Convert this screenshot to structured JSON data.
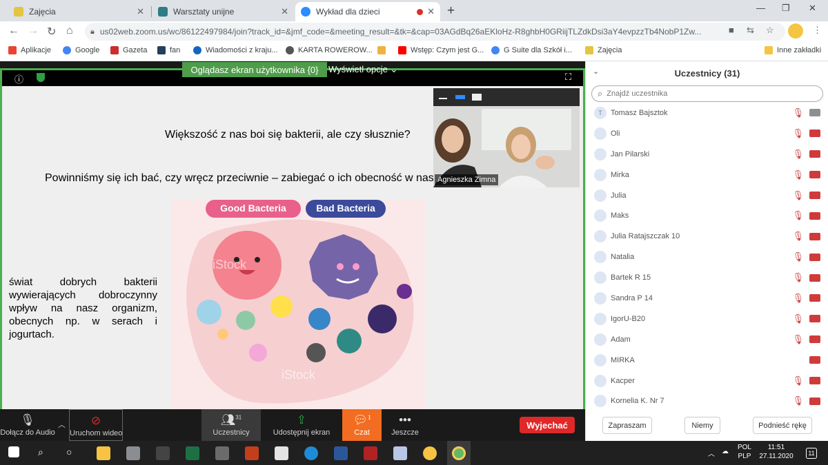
{
  "browser": {
    "tabs": [
      {
        "title": "Zajęcia",
        "color": "#e4c542"
      },
      {
        "title": "Warsztaty unijne",
        "color": "#2c7d87"
      },
      {
        "title": "Wykład dla dzieci",
        "color": "#2d8cff"
      }
    ],
    "new_tab": "+",
    "url": "us02web.zoom.us/wc/86122497984/join?track_id=&jmf_code=&meeting_result=&tk=&cap=03AGdBq26aEKloHz-R8ghbH0GRiijTLZdkDsi3aY4evpzzTb4NobP1Zw...",
    "bookmarks": [
      {
        "label": "Aplikacje",
        "color": "#ea4335"
      },
      {
        "label": "Google",
        "color": "#4285f4"
      },
      {
        "label": "Gazeta",
        "color": "#c9302c"
      },
      {
        "label": "fan",
        "color": "#22405c"
      },
      {
        "label": "Wiadomości z kraju...",
        "color": "#1565c0"
      },
      {
        "label": "KARTA ROWEROW...",
        "color": "#555555"
      },
      {
        "label": "",
        "color": "#f0b23e"
      },
      {
        "label": "Wstęp: Czym jest G...",
        "color": "#ff0000"
      },
      {
        "label": "G Suite dla Szkół i...",
        "color": "#4285f4"
      },
      {
        "label": "Zajęcia",
        "color": "#e4c542"
      }
    ],
    "other_bookmarks": "Inne zakładki"
  },
  "zoom": {
    "share_banner": "Oglądasz ekran użytkownika {0}",
    "view_options": "Wyświetl opcje",
    "slide": {
      "question": "Większość z nas boi się bakterii, ale czy słusznie?",
      "subquestion": "Powinniśmy się ich bać, czy wręcz przeciwnie – zabiegać o ich obecność w nasz",
      "body": "świat dobrych bakterii wywierających dobroczynny wpływ na nasz organizm, obecnych np. w serach i jogurtach.",
      "good_label": "Good Bacteria",
      "bad_label": "Bad Bacteria",
      "watermark": "iStock"
    },
    "video_name": "Agnieszka Zimna",
    "toolbar": {
      "audio": "Dołącz do Audio",
      "video": "Uruchom wideo",
      "participants": "Uczestnicy",
      "participants_count": "31",
      "share": "Udostępnij ekran",
      "chat": "Czat",
      "chat_badge": "1",
      "more": "Jeszcze",
      "leave": "Wyjechać"
    },
    "panel": {
      "title": "Uczestnicy (31)",
      "search_placeholder": "Znajdź uczestnika",
      "participants": [
        {
          "name": "Tomasz Bajsztok",
          "initial": "T"
        },
        {
          "name": "Oli",
          "initial": ""
        },
        {
          "name": "Jan Pilarski",
          "initial": ""
        },
        {
          "name": "Mirka",
          "initial": ""
        },
        {
          "name": "Julia",
          "initial": ""
        },
        {
          "name": "Maks",
          "initial": ""
        },
        {
          "name": "Julia Ratajszczak 10",
          "initial": ""
        },
        {
          "name": "Natalia",
          "initial": ""
        },
        {
          "name": "Bartek R 15",
          "initial": ""
        },
        {
          "name": "Sandra P 14",
          "initial": ""
        },
        {
          "name": "IgorU-B20",
          "initial": ""
        },
        {
          "name": "Adam",
          "initial": ""
        },
        {
          "name": "MIRKA",
          "initial": ""
        },
        {
          "name": "Kacper",
          "initial": ""
        },
        {
          "name": "Kornelia K. Nr 7",
          "initial": ""
        }
      ],
      "invite": "Zapraszam",
      "mute": "Niemy",
      "raise_hand": "Podnieść rękę"
    }
  },
  "taskbar": {
    "lang1": "POL",
    "lang2": "PLP",
    "time": "11:51",
    "date": "27.11.2020",
    "notifications": "11"
  }
}
